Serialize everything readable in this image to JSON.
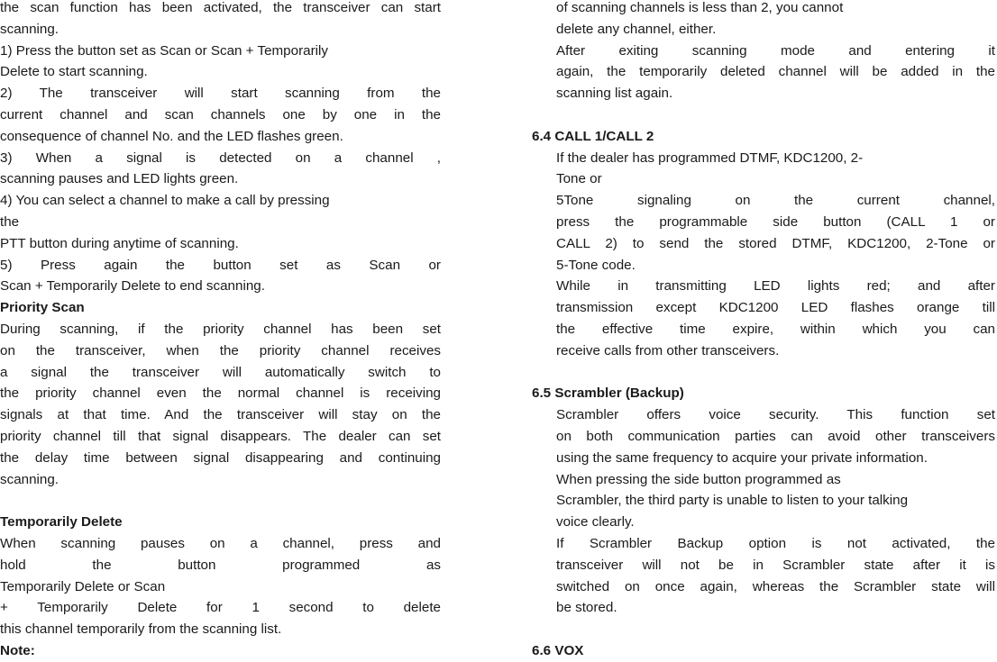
{
  "left": {
    "lines": [
      {
        "text": "the scan function has been activated, the transceiver can start",
        "style": "j"
      },
      {
        "text": "scanning.",
        "style": "l"
      },
      {
        "text": "1)        Press the button set as Scan       or Scan + Temporarily",
        "style": "l"
      },
      {
        "text": "Delete     to start scanning.",
        "style": "l"
      },
      {
        "text": "2) The transceiver will start scanning from the",
        "style": "j"
      },
      {
        "text": "current channel and scan channels one by one in the",
        "style": "j"
      },
      {
        "text": "consequence of channel No. and the LED flashes green.",
        "style": "l"
      },
      {
        "text": "3) When a signal is detected on a channel ,",
        "style": "j"
      },
      {
        "text": "scanning pauses and LED lights green.",
        "style": "l"
      },
      {
        "text": "4)        You can select a channel to make a call by pressing",
        "style": "l"
      },
      {
        "text": "the",
        "style": "l"
      },
      {
        "text": "PTT button during anytime of scanning.",
        "style": "l"
      },
      {
        "text": "5) Press again the button set as Scan or",
        "style": "j"
      },
      {
        "text": "        Scan   + Temporarily Delete     to end scanning.",
        "style": "l"
      },
      {
        "text": "Priority Scan",
        "style": "h"
      },
      {
        "text": "During scanning, if the priority channel has been set",
        "style": "j"
      },
      {
        "text": "on the transceiver, when the priority channel receives",
        "style": "j"
      },
      {
        "text": "a signal the transceiver will automatically switch to",
        "style": "j"
      },
      {
        "text": "the priority channel even the normal channel is receiving",
        "style": "j"
      },
      {
        "text": "signals at that time. And the transceiver will stay on the",
        "style": "j"
      },
      {
        "text": "priority channel till that signal disappears. The dealer can set",
        "style": "j"
      },
      {
        "text": "the delay time between signal disappearing and continuing",
        "style": "j"
      },
      {
        "text": "scanning.",
        "style": "l"
      },
      {
        "text": "",
        "style": "l"
      },
      {
        "text": "Temporarily Delete",
        "style": "h"
      },
      {
        "text": "When scanning pauses on a channel, press and",
        "style": "j"
      },
      {
        "text": "hold the button programmed as",
        "style": "j"
      },
      {
        "text": "                                             Temporarily   Delete       or        Scan",
        "style": "l"
      },
      {
        "text": "+ Temporarily Delete for 1 second to delete",
        "style": "j"
      },
      {
        "text": "this    channel temporarily from the scanning list.",
        "style": "l"
      },
      {
        "text": "Note:",
        "style": "h"
      }
    ]
  },
  "right": {
    "lines": [
      {
        "text": "of scanning channels is less than 2, you cannot",
        "style": "l"
      },
      {
        "text": "delete   any channel, either.",
        "style": "l"
      },
      {
        "text": "After exiting scanning mode and entering it",
        "style": "j"
      },
      {
        "text": "again,     the temporarily deleted channel will be added in the",
        "style": "j"
      },
      {
        "text": "scanning list again.",
        "style": "l"
      },
      {
        "text": "",
        "style": "l"
      },
      {
        "text": "6.4 CALL 1/CALL 2",
        "style": "h"
      },
      {
        "text": "If the dealer has programmed DTMF, KDC1200, 2-",
        "style": "l"
      },
      {
        "text": "Tone   or",
        "style": "l"
      },
      {
        "text": "5Tone signaling on the current channel,",
        "style": "j"
      },
      {
        "text": "press the programmable side button (CALL 1 or",
        "style": "j"
      },
      {
        "text": "CALL 2) to send the stored DTMF, KDC1200, 2-Tone or",
        "style": "j"
      },
      {
        "text": "5-Tone code.",
        "style": "l"
      },
      {
        "text": "While in transmitting LED lights red; and after",
        "style": "j"
      },
      {
        "text": "transmission except KDC1200 LED flashes orange till",
        "style": "j"
      },
      {
        "text": "the effective time expire, within which you can",
        "style": "j"
      },
      {
        "text": "receive      calls      from      other transceivers.",
        "style": "l"
      },
      {
        "text": "",
        "style": "l"
      },
      {
        "text": "6.5 Scrambler (Backup)",
        "style": "h"
      },
      {
        "text": "Scrambler offers voice security. This function set",
        "style": "j"
      },
      {
        "text": "on both communication parties can avoid other transceivers",
        "style": "j"
      },
      {
        "text": "using the same frequency to acquire your private information.",
        "style": "l"
      },
      {
        "text": "When   pressing   the   side   button   programmed   as",
        "style": "l"
      },
      {
        "text": "Scrambler, the third party is unable to listen to your talking",
        "style": "l"
      },
      {
        "text": "voice clearly.",
        "style": "l"
      },
      {
        "text": "If Scrambler Backup option is not activated, the",
        "style": "j"
      },
      {
        "text": "transceiver will not be in Scrambler state after it is",
        "style": "j"
      },
      {
        "text": "switched on once again, whereas the Scrambler state will",
        "style": "j"
      },
      {
        "text": "be stored.",
        "style": "l"
      },
      {
        "text": "",
        "style": "l"
      },
      {
        "text": "6.6 VOX",
        "style": "h"
      }
    ]
  }
}
